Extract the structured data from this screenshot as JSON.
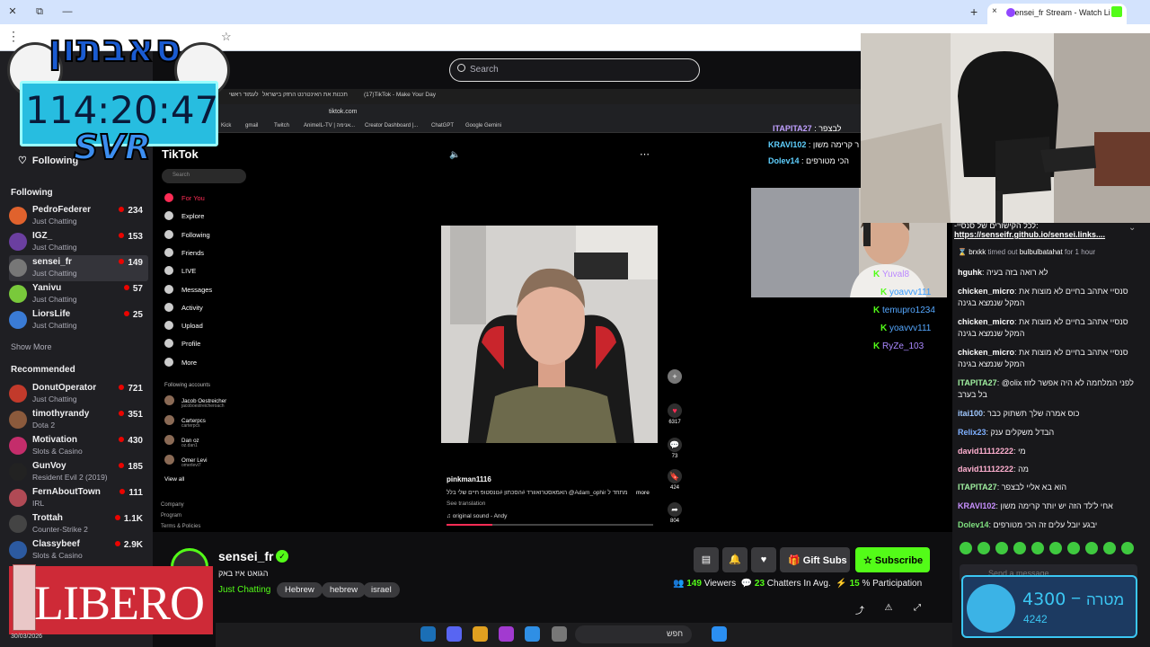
{
  "browser": {
    "tab_title": "sensei_fr Stream - Watch Li",
    "tab_close": "×",
    "new_tab": "+",
    "win_controls": [
      "✕",
      "⧉",
      "—"
    ],
    "menu": "⋮",
    "bookmark": "☆"
  },
  "overlay": {
    "logo_text": "סאבתון",
    "timer": "114:20:47",
    "svr": "SVR",
    "sponsor": "LIBERO",
    "goal": {
      "current": "4300",
      "dash": "−",
      "label": "מטרה",
      "sub": "4242"
    },
    "date": "30/03/2026"
  },
  "topbar": {
    "search_placeholder": "Search",
    "following_label": "Following"
  },
  "sidebar": {
    "following_header": "Following",
    "following": [
      {
        "name": "PedroFederer",
        "game": "Just Chatting",
        "viewers": "234",
        "color": "#e0622d"
      },
      {
        "name": "IGZ_",
        "game": "Just Chatting",
        "viewers": "153",
        "color": "#6b3fa0"
      },
      {
        "name": "sensei_fr",
        "game": "Just Chatting",
        "viewers": "149",
        "color": "#777777"
      },
      {
        "name": "Yanivu",
        "game": "Just Chatting",
        "viewers": "57",
        "color": "#79c93b"
      },
      {
        "name": "LiorsLife",
        "game": "Just Chatting",
        "viewers": "25",
        "color": "#3a7bd5"
      }
    ],
    "show_more": "Show More",
    "recommended_header": "Recommended",
    "recommended": [
      {
        "name": "DonutOperator",
        "game": "Just Chatting",
        "viewers": "721",
        "color": "#c23a2b"
      },
      {
        "name": "timothyrandy",
        "game": "Dota 2",
        "viewers": "351",
        "color": "#8b5a3c"
      },
      {
        "name": "Motivation",
        "game": "Slots & Casino",
        "viewers": "430",
        "color": "#c42d6b"
      },
      {
        "name": "GunVoy",
        "game": "Resident Evil 2 (2019)",
        "viewers": "185",
        "color": "#222222"
      },
      {
        "name": "FernAboutTown",
        "game": "IRL",
        "viewers": "111",
        "color": "#b04a55"
      },
      {
        "name": "Trottah",
        "game": "Counter-Strike 2",
        "viewers": "1.1K",
        "color": "#444444"
      },
      {
        "name": "Classybeef",
        "game": "Slots & Casino",
        "viewers": "2.9K",
        "color": "#2c5aa0"
      }
    ]
  },
  "inner_browser": {
    "tabs": [
      "לעמוד ראשי",
      "תכנות את האינטרנט החזק בישראל",
      "(17)TikTok - Make Your Day"
    ],
    "url": "tiktok.com",
    "bookmarks": [
      "Kick",
      "gmail",
      "Twitch",
      "AnimeIL-TV | אנימה...",
      "Creator Dashboard |...",
      "ChatGPT",
      "Google Gemini"
    ]
  },
  "tiktok": {
    "logo": "TikTok",
    "search": "Search",
    "nav": [
      "For You",
      "Explore",
      "Following",
      "Friends",
      "LIVE",
      "Messages",
      "Activity",
      "Upload",
      "Profile",
      "More"
    ],
    "following_accounts_label": "Following accounts",
    "accounts": [
      {
        "name": "Jacob Oestreicher",
        "handle": "jacoboestreicheroach"
      },
      {
        "name": "Carterpcs",
        "handle": "carterpcs"
      },
      {
        "name": "Dan oz",
        "handle": "oz.dan1"
      },
      {
        "name": "Omer Levi",
        "handle": "omerlevi7"
      }
    ],
    "view_all": "View all",
    "footer": [
      "Company",
      "Program",
      "Terms & Policies"
    ],
    "video_user": "pinkman1116",
    "video_desc": "האמאסטרואוורד #הסכתון #נונסטופ חיים שלי בלל @Adam_ophir מתחד ל",
    "more": "more",
    "see_translation": "See translation",
    "sound": "original sound - Andy",
    "progress": 0.22,
    "actions": [
      {
        "icon": "+",
        "count": ""
      },
      {
        "icon": "♥",
        "count": "6317"
      },
      {
        "icon": "💬",
        "count": "73"
      },
      {
        "icon": "🔖",
        "count": "424"
      },
      {
        "icon": "➦",
        "count": "804"
      }
    ]
  },
  "overlay_chat": [
    {
      "user": "ITAPITA27",
      "text": "לבצפר"
    },
    {
      "user": "KRAVI102",
      "text": "ר קרימה משון"
    },
    {
      "user": "Dolev14",
      "text": "הכי מטורפים"
    }
  ],
  "overlay_users": [
    {
      "user": "Yuval8",
      "color": "#bb88ff"
    },
    {
      "user": "yoavvv111",
      "color": "#3399ff"
    },
    {
      "user": "temupro1234",
      "color": "#55a8ff"
    },
    {
      "user": "yoavvv111",
      "color": "#55a8ff"
    },
    {
      "user": "RyZe_103",
      "color": "#aa88ff"
    }
  ],
  "stream": {
    "name": "sensei_fr",
    "title": "הגואט איז באק",
    "category": "Just Chatting",
    "tags": [
      "Hebrew",
      "hebrew",
      "israel"
    ],
    "gift_subs": "Gift Subs",
    "subscribe": "Subscribe",
    "viewers": "149",
    "viewers_label": "Viewers",
    "chatters": "23",
    "chatters_label": "Chatters In Avg.",
    "participation": "15",
    "participation_label": "% Participation"
  },
  "chat": {
    "pinned_text": "-לכל הקישורים של סנסיי:",
    "pinned_link": "https://senseifr.github.io/sensei.links....",
    "timeout_user": "brxkk",
    "timeout_text": "timed out",
    "timeout_target": "bulbulbatahat",
    "timeout_dur": "for 1 hour",
    "messages": [
      {
        "user": "hguhk",
        "color": "#ffffff",
        "text": "לא רואה בזה בעיה"
      },
      {
        "user": "chicken_micro",
        "color": "#ffffff",
        "text": "סנסיי אתהב בחיים לא מוצות את המקל שנמצא בגינה"
      },
      {
        "user": "chicken_micro",
        "color": "#ffffff",
        "text": "סנסיי אתהב בחיים לא מוצות את המקל שנמצא בגינה"
      },
      {
        "user": "chicken_micro",
        "color": "#ffffff",
        "text": "סנסיי אתהב בחיים לא מוצות את המקל שנמצא בגינה"
      },
      {
        "user": "ITAPITA27",
        "color": "#a0f0a0",
        "text": "@olix לפני המלחמה לא היה אפשר לזוז בל בערב"
      },
      {
        "user": "itai100",
        "color": "#a0c8ff",
        "text": "כוס אמרה שלך תשתוק כבר"
      },
      {
        "user": "Relix23",
        "color": "#7fb0ff",
        "text": "הבדל משקלים ענק"
      },
      {
        "user": "david11112222",
        "color": "#ffb0d0",
        "text": "מי"
      },
      {
        "user": "david11112222",
        "color": "#ffb0d0",
        "text": "מה"
      },
      {
        "user": "ITAPITA27",
        "color": "#a0f0a0",
        "text": "הוא בא אליי לבצפר"
      },
      {
        "user": "KRAVI102",
        "color": "#c890ff",
        "text": "אחי ל'לד הזה יש יותר קרימה משון"
      },
      {
        "user": "Dolev14",
        "color": "#7fe07f",
        "text": "יבגע יובל עלים זה הכי מטורפים"
      }
    ],
    "input_placeholder": "Send a message"
  },
  "taskbar": {
    "search": "חפש"
  }
}
